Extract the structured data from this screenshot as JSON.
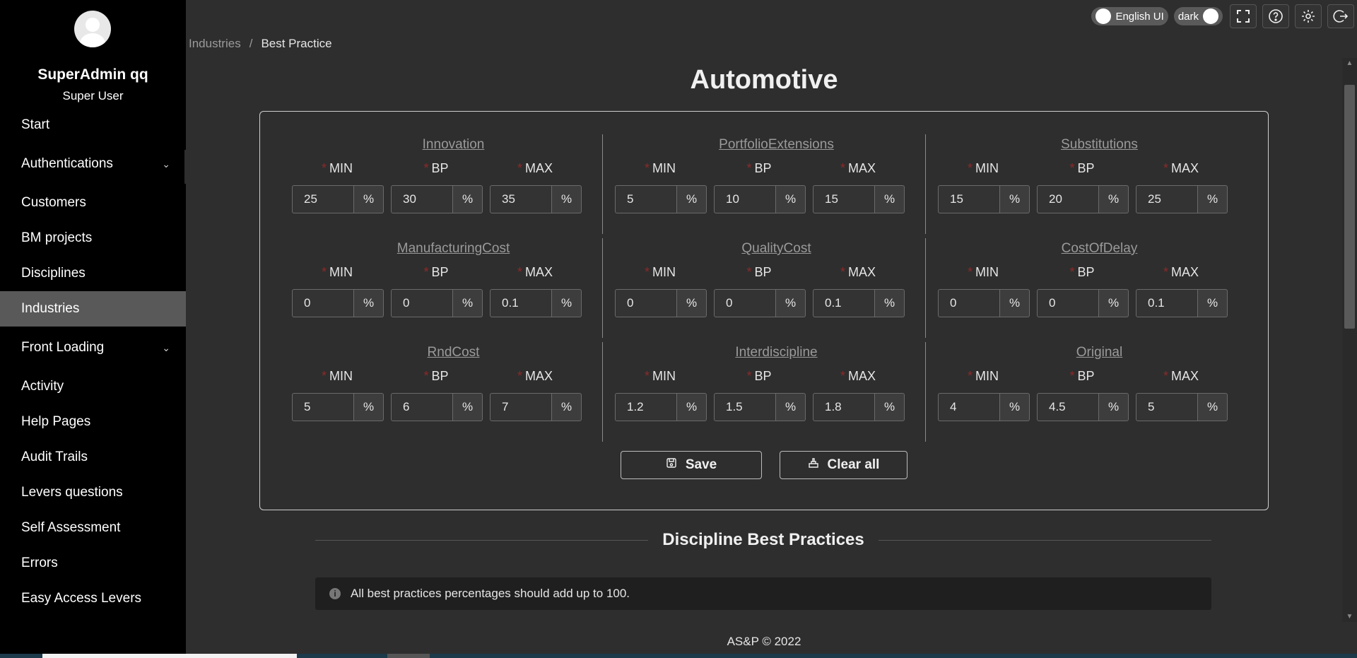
{
  "user": {
    "name": "SuperAdmin qq",
    "role": "Super User"
  },
  "sidebar": {
    "items": [
      {
        "label": "Start"
      },
      {
        "label": "Authentications",
        "chevron": "chevron-down-icon"
      },
      {
        "label": "Customers"
      },
      {
        "label": "BM projects"
      },
      {
        "label": "Disciplines"
      },
      {
        "label": "Industries",
        "active": true
      },
      {
        "label": "Front Loading",
        "chevron": "chevron-down-icon"
      },
      {
        "label": "Activity"
      },
      {
        "label": "Help Pages"
      },
      {
        "label": "Audit Trails"
      },
      {
        "label": "Levers questions"
      },
      {
        "label": "Self Assessment"
      },
      {
        "label": "Errors"
      },
      {
        "label": "Easy Access Levers"
      }
    ]
  },
  "topbar": {
    "language_toggle": "English UI",
    "theme_toggle": "dark",
    "icons": [
      "fullscreen-icon",
      "help-icon",
      "settings-icon",
      "logout-icon"
    ]
  },
  "breadcrumb": {
    "parent": "Industries",
    "separator": "/",
    "current": "Best Practice"
  },
  "page_title": "Automotive",
  "labels": {
    "min": "MIN",
    "bp": "BP",
    "max": "MAX",
    "required": "*",
    "unit": "%"
  },
  "groups": [
    {
      "title": "Innovation",
      "min": "25",
      "bp": "30",
      "max": "35"
    },
    {
      "title": "PortfolioExtensions",
      "min": "5",
      "bp": "10",
      "max": "15"
    },
    {
      "title": "Substitutions",
      "min": "15",
      "bp": "20",
      "max": "25"
    },
    {
      "title": "ManufacturingCost",
      "min": "0",
      "bp": "0",
      "max": "0.1"
    },
    {
      "title": "QualityCost",
      "min": "0",
      "bp": "0",
      "max": "0.1"
    },
    {
      "title": "CostOfDelay",
      "min": "0",
      "bp": "0",
      "max": "0.1"
    },
    {
      "title": "RndCost",
      "min": "5",
      "bp": "6",
      "max": "7"
    },
    {
      "title": "Interdiscipline",
      "min": "1.2",
      "bp": "1.5",
      "max": "1.8"
    },
    {
      "title": "Original",
      "min": "4",
      "bp": "4.5",
      "max": "5"
    }
  ],
  "actions": {
    "save": "Save",
    "clear": "Clear all"
  },
  "section": {
    "title": "Discipline Best Practices"
  },
  "alert": {
    "text": "All best practices percentages should add up to 100.",
    "icon": "info-icon"
  },
  "footer": "AS&P © 2022",
  "colors": {
    "required_star": "#8b2a2a",
    "active_menu": "#595959",
    "background": "#2e2e2e"
  }
}
